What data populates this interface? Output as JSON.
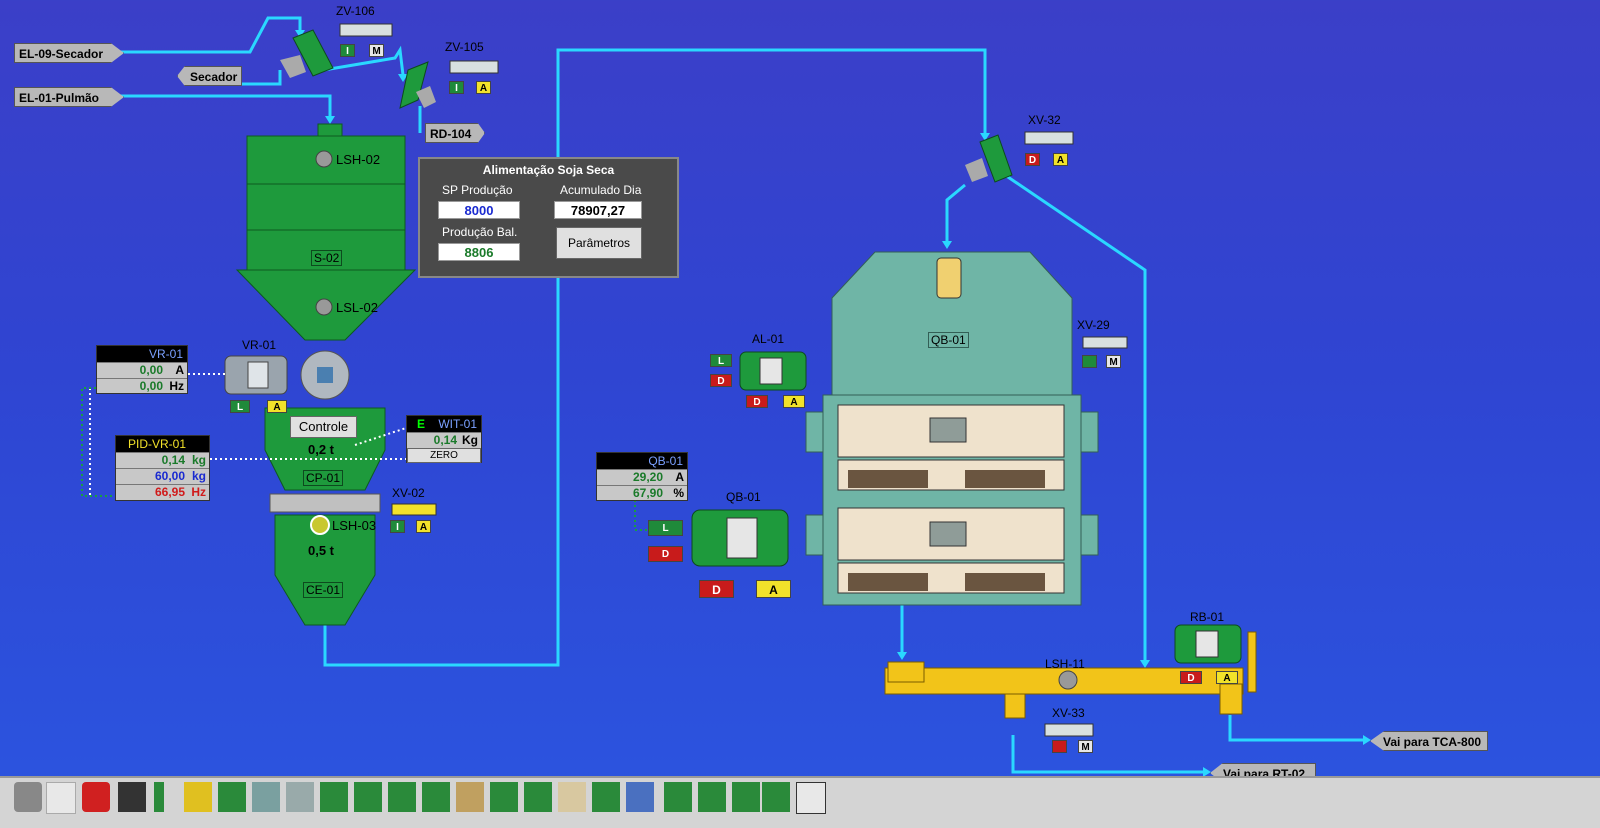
{
  "tags": {
    "el09": "EL-09-Secador",
    "secador": "Secador",
    "el01": "EL-01-Pulmão",
    "rd104": "RD-104",
    "tca": "Vai para TCA-800",
    "rt02": "Vai para RT-02"
  },
  "valves": {
    "zv106": "ZV-106",
    "zv105": "ZV-105",
    "xv32": "XV-32",
    "xv29": "XV-29",
    "xv02": "XV-02",
    "xv33": "XV-33"
  },
  "equipment": {
    "silo": "S-02",
    "lsh02": "LSH-02",
    "lsl02": "LSL-02",
    "vr01": "VR-01",
    "cp01": "CP-01",
    "cp01_weight": "0,2 t",
    "ce01": "CE-01",
    "ce01_weight": "0,5 t",
    "lsh03": "LSH-03",
    "al01": "AL-01",
    "qb01_motor": "QB-01",
    "qb01_dryer": "QB-01",
    "rb01": "RB-01",
    "lsh11": "LSH-11"
  },
  "mode_letters": {
    "L": "L",
    "A": "A",
    "M": "M",
    "D": "D",
    "E": "E",
    "I": "I"
  },
  "panel": {
    "title": "Alimentação Soja Seca",
    "sp_label": "SP Produção",
    "sp_value": "8000",
    "acc_label": "Acumulado Dia",
    "acc_value": "78907,27",
    "prod_label": "Produção Bal.",
    "prod_value": "8806",
    "params_button": "Parâmetros"
  },
  "vr01_box": {
    "header": "VR-01",
    "current": "0,00",
    "current_unit": "A",
    "freq": "0,00",
    "freq_unit": "Hz"
  },
  "pid_box": {
    "header": "PID-VR-01",
    "pv": "0,14",
    "pv_unit": "kg",
    "sp": "60,00",
    "sp_unit": "kg",
    "out": "66,95",
    "out_unit": "Hz"
  },
  "wit_box": {
    "header": "WIT-01",
    "value": "0,14",
    "unit": "Kg",
    "zero": "ZERO"
  },
  "qb01_box": {
    "header": "QB-01",
    "current": "29,20",
    "current_unit": "A",
    "pct": "67,90",
    "pct_unit": "%"
  },
  "controle_button": "Controle",
  "colors": {
    "pipe": "#2ad8ff",
    "silo": "#1e9a3c",
    "dryer": "#6fb5a6",
    "conveyor": "#f2c419",
    "background": "#3144d0"
  }
}
